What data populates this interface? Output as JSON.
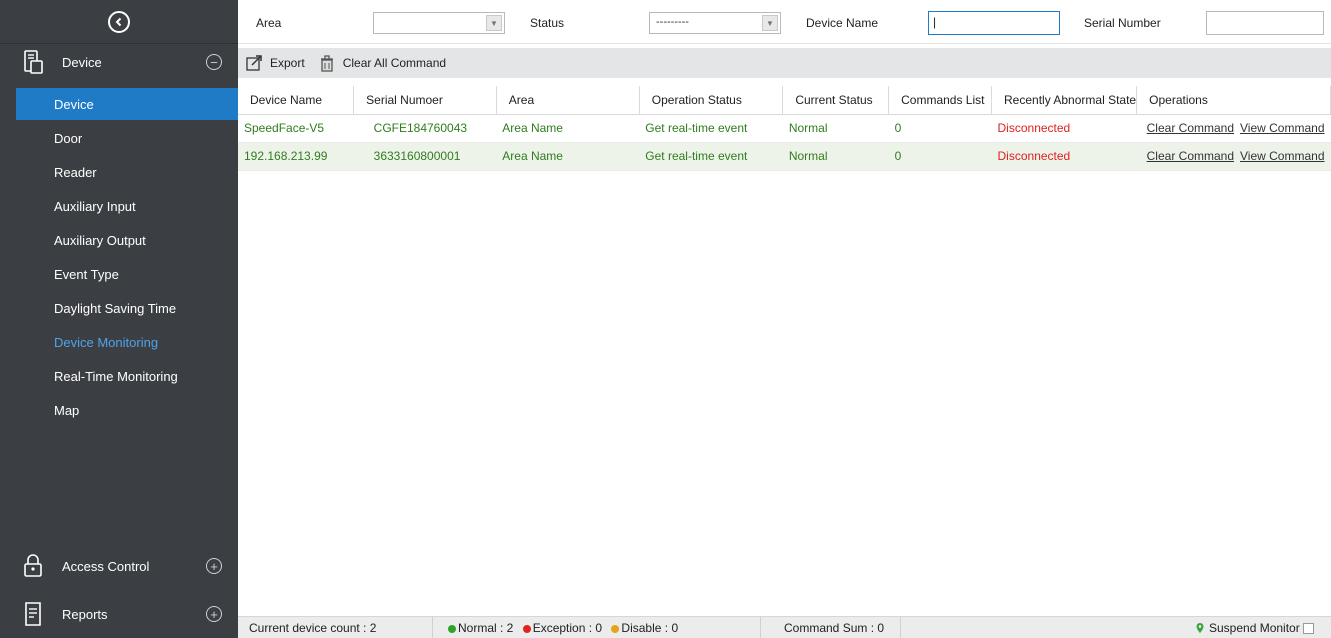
{
  "sidebar": {
    "sections": {
      "device": {
        "label": "Device",
        "icon": "device-icon",
        "toggle": "⊖"
      },
      "access_control": {
        "label": "Access Control",
        "icon": "lock-icon",
        "toggle": "⊕"
      },
      "reports": {
        "label": "Reports",
        "icon": "reports-icon",
        "toggle": "⊕"
      }
    },
    "items": [
      {
        "label": "Device",
        "state": "active"
      },
      {
        "label": "Door",
        "state": ""
      },
      {
        "label": "Reader",
        "state": ""
      },
      {
        "label": "Auxiliary Input",
        "state": ""
      },
      {
        "label": "Auxiliary Output",
        "state": ""
      },
      {
        "label": "Event Type",
        "state": ""
      },
      {
        "label": "Daylight Saving Time",
        "state": ""
      },
      {
        "label": "Device Monitoring",
        "state": "highlight"
      },
      {
        "label": "Real-Time Monitoring",
        "state": ""
      },
      {
        "label": "Map",
        "state": ""
      }
    ]
  },
  "filters": {
    "area_label": "Area",
    "area_value": "",
    "status_label": "Status",
    "status_value": "---------",
    "device_name_label": "Device Name",
    "device_name_value": "|",
    "serial_label": "Serial Number",
    "serial_value": ""
  },
  "toolbar": {
    "export_label": "Export",
    "clear_all_label": "Clear All Command"
  },
  "table": {
    "columns": [
      "Device Name",
      "Serial Numoer",
      "Area",
      "Operation Status",
      "Current Status",
      "Commands List",
      "Recently Abnormal State",
      "Operations"
    ],
    "rows": [
      {
        "device_name": "SpeedFace-V5",
        "serial": "CGFE184760043",
        "area": "Area Name",
        "op_status": "Get real-time event",
        "current_status": "Normal",
        "commands": "0",
        "abnormal": "Disconnected",
        "op1": "Clear Command",
        "op2": "View Command"
      },
      {
        "device_name": "192.168.213.99",
        "serial": "3633160800001",
        "area": "Area Name",
        "op_status": "Get real-time event",
        "current_status": "Normal",
        "commands": "0",
        "abnormal": "Disconnected",
        "op1": "Clear Command",
        "op2": "View Command"
      }
    ]
  },
  "status": {
    "device_count": "Current device count : 2",
    "normal": "Normal : 2",
    "exception": "Exception : 0",
    "disable": "Disable : 0",
    "command_sum": "Command Sum : 0",
    "suspend": "Suspend Monitor"
  },
  "colors": {
    "sidebar_bg": "#3b3f44",
    "active_item": "#1f7bc6",
    "highlight_text": "#4fa3e6",
    "row_text_green": "#2f7d1e",
    "disconnected_red": "#d22222",
    "dot_normal": "#2aa52a",
    "dot_exception": "#e02222",
    "dot_disable": "#e6a317"
  }
}
